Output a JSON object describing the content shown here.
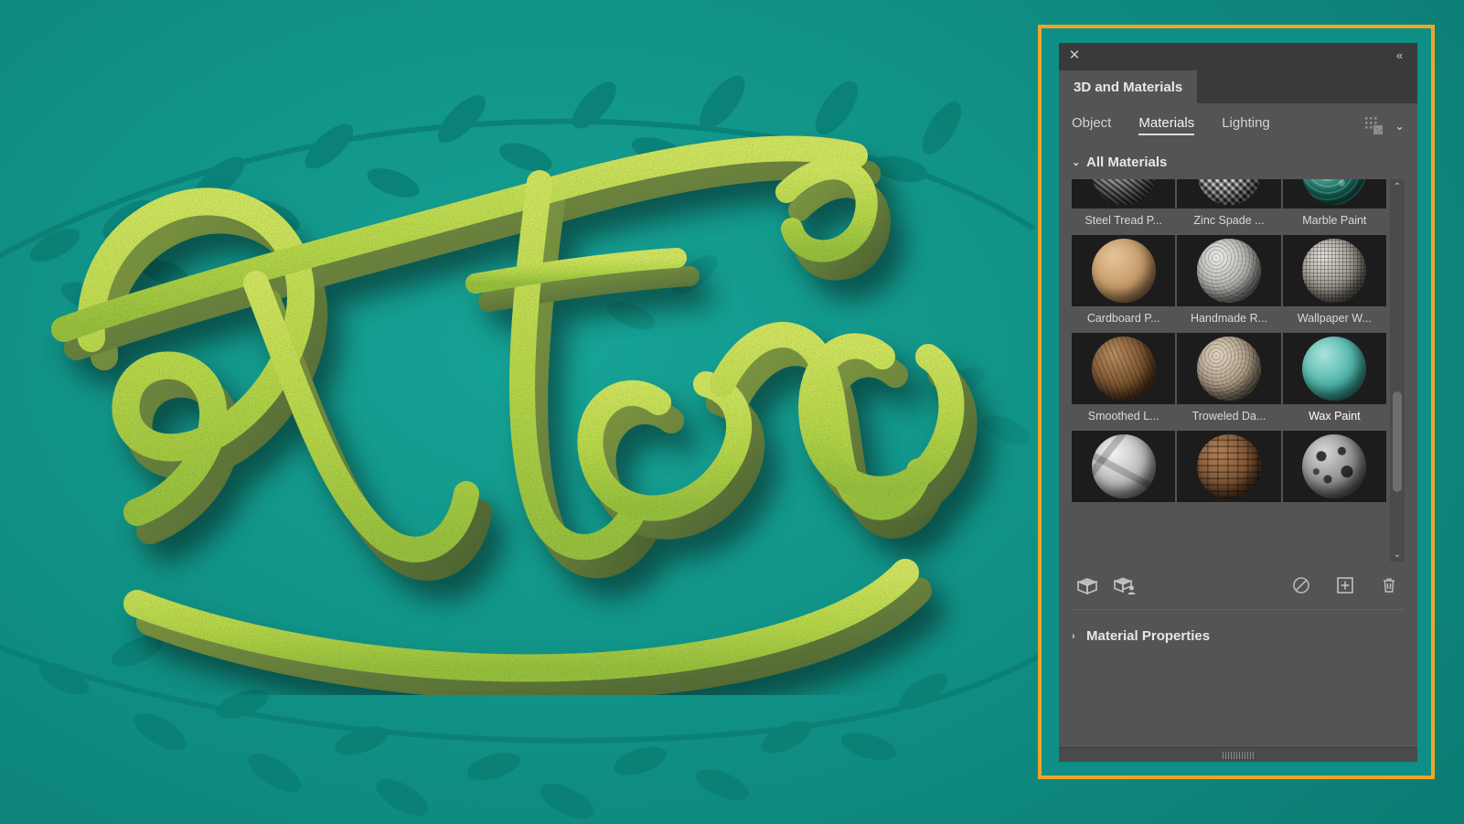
{
  "artwork": {
    "title": "Flora",
    "letters": "Flora",
    "background_color": "#0e8f85",
    "accent_color": "#c3e34d",
    "shadow_color": "#5f7a2e",
    "vine_color": "#0b7f74"
  },
  "panel": {
    "titlebar": {
      "close_icon": "close-icon",
      "close_glyph": "✕",
      "collapse_icon": "collapse-panel-icon",
      "collapse_glyph": "«"
    },
    "tab_label": "3D and Materials",
    "segments": [
      {
        "label": "Object",
        "active": false
      },
      {
        "label": "Materials",
        "active": true
      },
      {
        "label": "Lighting",
        "active": false
      }
    ],
    "segment_right": {
      "dither_icon": "gradient-dither-icon",
      "chevron_icon": "chevron-down-icon",
      "chevron_glyph": "⌄"
    },
    "all_materials": {
      "label": "All Materials",
      "twisty_glyph": "⌄",
      "expanded": true
    },
    "materials": [
      {
        "name": "Steel Tread P...",
        "full_name": "Steel Tread Plate",
        "c1": "#cfcfcf",
        "c2": "#4a4a4a",
        "c3": "#1e1e1e",
        "pattern": "tread",
        "selected": false
      },
      {
        "name": "Zinc Spade ...",
        "full_name": "Zinc Spade",
        "c1": "#f2f2f2",
        "c2": "#8f8f8f",
        "c3": "#2c2c2c",
        "pattern": "diamond",
        "selected": false
      },
      {
        "name": "Marble Paint",
        "full_name": "Marble Paint",
        "c1": "#a9ded7",
        "c2": "#12705f",
        "c3": "#07322c",
        "pattern": "marble",
        "selected": false
      },
      {
        "name": "Cardboard P...",
        "full_name": "Cardboard Paper",
        "c1": "#e5c397",
        "c2": "#c59a68",
        "c3": "#6b4c2d",
        "pattern": "smooth",
        "selected": false
      },
      {
        "name": "Handmade R...",
        "full_name": "Handmade Rough",
        "c1": "#e8e8e6",
        "c2": "#a9a9a5",
        "c3": "#4d4d4b",
        "pattern": "rough",
        "selected": false
      },
      {
        "name": "Wallpaper W...",
        "full_name": "Wallpaper Weave",
        "c1": "#e3e0da",
        "c2": "#9a938a",
        "c3": "#3e3a35",
        "pattern": "weave",
        "selected": false
      },
      {
        "name": "Smoothed L...",
        "full_name": "Smoothed Leather",
        "c1": "#b58a5e",
        "c2": "#79532f",
        "c3": "#33210f",
        "pattern": "grain",
        "selected": false
      },
      {
        "name": "Troweled Da...",
        "full_name": "Troweled Daub",
        "c1": "#ded1bd",
        "c2": "#a6937b",
        "c3": "#4d4236",
        "pattern": "rough",
        "selected": false
      },
      {
        "name": "Wax Paint",
        "full_name": "Wax Paint",
        "c1": "#a9e3dc",
        "c2": "#4bb3a8",
        "c3": "#175e57",
        "pattern": "smooth",
        "selected": true
      },
      {
        "name": "",
        "full_name": "Crumpled Foil",
        "c1": "#f4f4f4",
        "c2": "#b8b8b8",
        "c3": "#4a4a4a",
        "pattern": "crumple",
        "selected": false
      },
      {
        "name": "",
        "full_name": "Brick Wall",
        "c1": "#b08058",
        "c2": "#7d5433",
        "c3": "#331f10",
        "pattern": "brick",
        "selected": false
      },
      {
        "name": "",
        "full_name": "Cratered Rock",
        "c1": "#d8d8d8",
        "c2": "#8a8a8a",
        "c3": "#2a2a2a",
        "pattern": "crater",
        "selected": false
      }
    ],
    "scrollbar": {
      "up_glyph": "⌃",
      "down_glyph": "⌄"
    },
    "actions": {
      "left": [
        {
          "icon": "open-box-icon",
          "label": "Browse All Materials"
        },
        {
          "icon": "open-box-user-icon",
          "label": "Your Materials"
        }
      ],
      "right": [
        {
          "icon": "no-material-icon",
          "label": "No Material"
        },
        {
          "icon": "new-material-icon",
          "label": "New Material"
        },
        {
          "icon": "trash-icon",
          "label": "Delete Material"
        }
      ]
    },
    "material_properties": {
      "label": "Material Properties",
      "twisty_glyph": "›",
      "expanded": false
    },
    "colors": {
      "panel_bg": "#545454",
      "titlebar_bg": "#3a3a3a",
      "highlight_border": "#f0a32a",
      "thumb_bg": "#1c1c1c"
    }
  }
}
